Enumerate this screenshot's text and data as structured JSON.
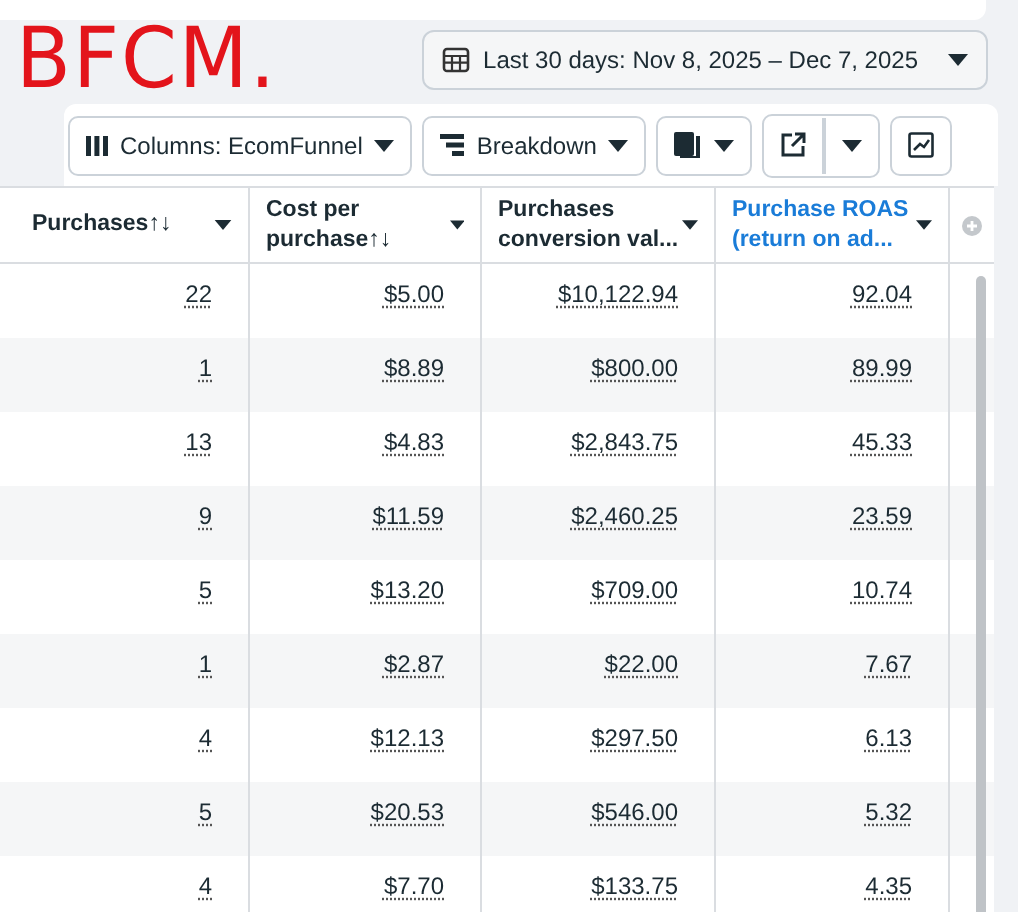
{
  "annotation": "BFCM.",
  "date_range": {
    "label": "Last 30 days: Nov 8, 2025 – Dec 7, 2025"
  },
  "toolbar": [
    {
      "kind": "columns",
      "label": "Columns: EcomFunnel"
    },
    {
      "kind": "breakdown",
      "label": "Breakdown"
    },
    {
      "kind": "reports"
    },
    {
      "kind": "export"
    },
    {
      "kind": "chart"
    }
  ],
  "table": {
    "columns": [
      {
        "label": "Purchases",
        "sort_icon": "↑↓",
        "highlighted": false
      },
      {
        "label": "Cost per purchase",
        "sort_icon": "↑↓",
        "highlighted": false
      },
      {
        "label": "Purchases conversion val...",
        "highlighted": false
      },
      {
        "label": "Purchase ROAS (return on ad...",
        "highlighted": true
      }
    ],
    "rows": [
      [
        "22",
        "$5.00",
        "$10,122.94",
        "92.04"
      ],
      [
        "1",
        "$8.89",
        "$800.00",
        "89.99"
      ],
      [
        "13",
        "$4.83",
        "$2,843.75",
        "45.33"
      ],
      [
        "9",
        "$11.59",
        "$2,460.25",
        "23.59"
      ],
      [
        "5",
        "$13.20",
        "$709.00",
        "10.74"
      ],
      [
        "1",
        "$2.87",
        "$22.00",
        "7.67"
      ],
      [
        "4",
        "$12.13",
        "$297.50",
        "6.13"
      ],
      [
        "5",
        "$20.53",
        "$546.00",
        "5.32"
      ],
      [
        "4",
        "$7.70",
        "$133.75",
        "4.35"
      ]
    ]
  }
}
